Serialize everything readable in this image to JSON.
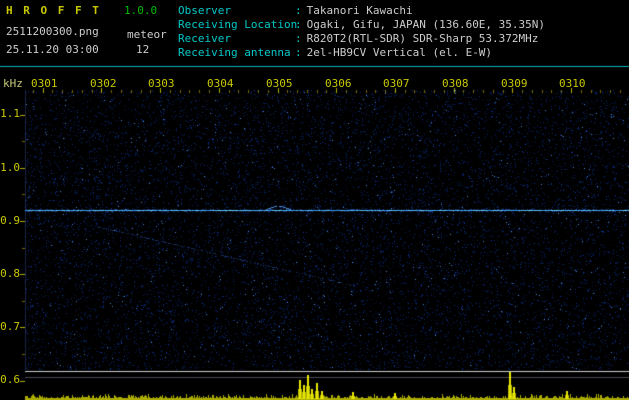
{
  "app": {
    "title": "H R O F F T",
    "version": "1.0.0",
    "filename": "2511200300.png",
    "mode": "meteor",
    "timestamp": "25.11.20 03:00",
    "count": "12"
  },
  "header": {
    "separator": ":",
    "fields": [
      {
        "label": "Observer",
        "value": "Takanori Kawachi"
      },
      {
        "label": "Receiving Location",
        "value": "Ogaki, Gifu, JAPAN (136.60E, 35.35N)"
      },
      {
        "label": "Receiver",
        "value": "R820T2(RTL-SDR) SDR-Sharp 53.372MHz"
      },
      {
        "label": "Receiving antenna",
        "value": "2el-HB9CV Vertical (el. E-W)"
      }
    ]
  },
  "colors": {
    "accent_cyan": "#00b7b7",
    "tick_yellow": "#c8c800",
    "value_white": "#cccccc",
    "version_green": "#00bb00",
    "noise_blue": "#14329b",
    "carrier_cyan": "#58a8ff",
    "spike_yellow": "#e8e800"
  },
  "chart_data": {
    "type": "heatmap",
    "subtype": "radio-meteor-spectrogram",
    "title": "",
    "ylabel": "kHz",
    "x_ticks": [
      "0301",
      "0302",
      "0303",
      "0304",
      "0305",
      "0306",
      "0307",
      "0308",
      "0309",
      "0310"
    ],
    "x_tick_interval": "1 minute",
    "y_ticks": [
      "1.1",
      "1.0",
      "0.9",
      "0.8",
      "0.7",
      "0.6"
    ],
    "y_range_khz": [
      0.6,
      1.15
    ],
    "grid": false,
    "legend": false,
    "features": {
      "background": "sparse dark-blue noise on black",
      "carrier_line_khz": 0.92,
      "meteor_echo": {
        "time": "0305:00",
        "khz": 0.93
      },
      "faint_trail": {
        "from": {
          "time": "0301:55",
          "khz": 0.89
        },
        "to": {
          "time": "0306:15",
          "khz": 0.78
        }
      },
      "boundary_line_khz": 0.62,
      "signal_spikes": [
        {
          "x": 299,
          "h": 19
        },
        {
          "x": 303,
          "h": 14
        },
        {
          "x": 307,
          "h": 24
        },
        {
          "x": 311,
          "h": 10
        },
        {
          "x": 316,
          "h": 16
        },
        {
          "x": 321,
          "h": 8
        },
        {
          "x": 352,
          "h": 7
        },
        {
          "x": 394,
          "h": 6
        },
        {
          "x": 509,
          "h": 27
        },
        {
          "x": 513,
          "h": 12
        },
        {
          "x": 566,
          "h": 8
        }
      ]
    }
  }
}
